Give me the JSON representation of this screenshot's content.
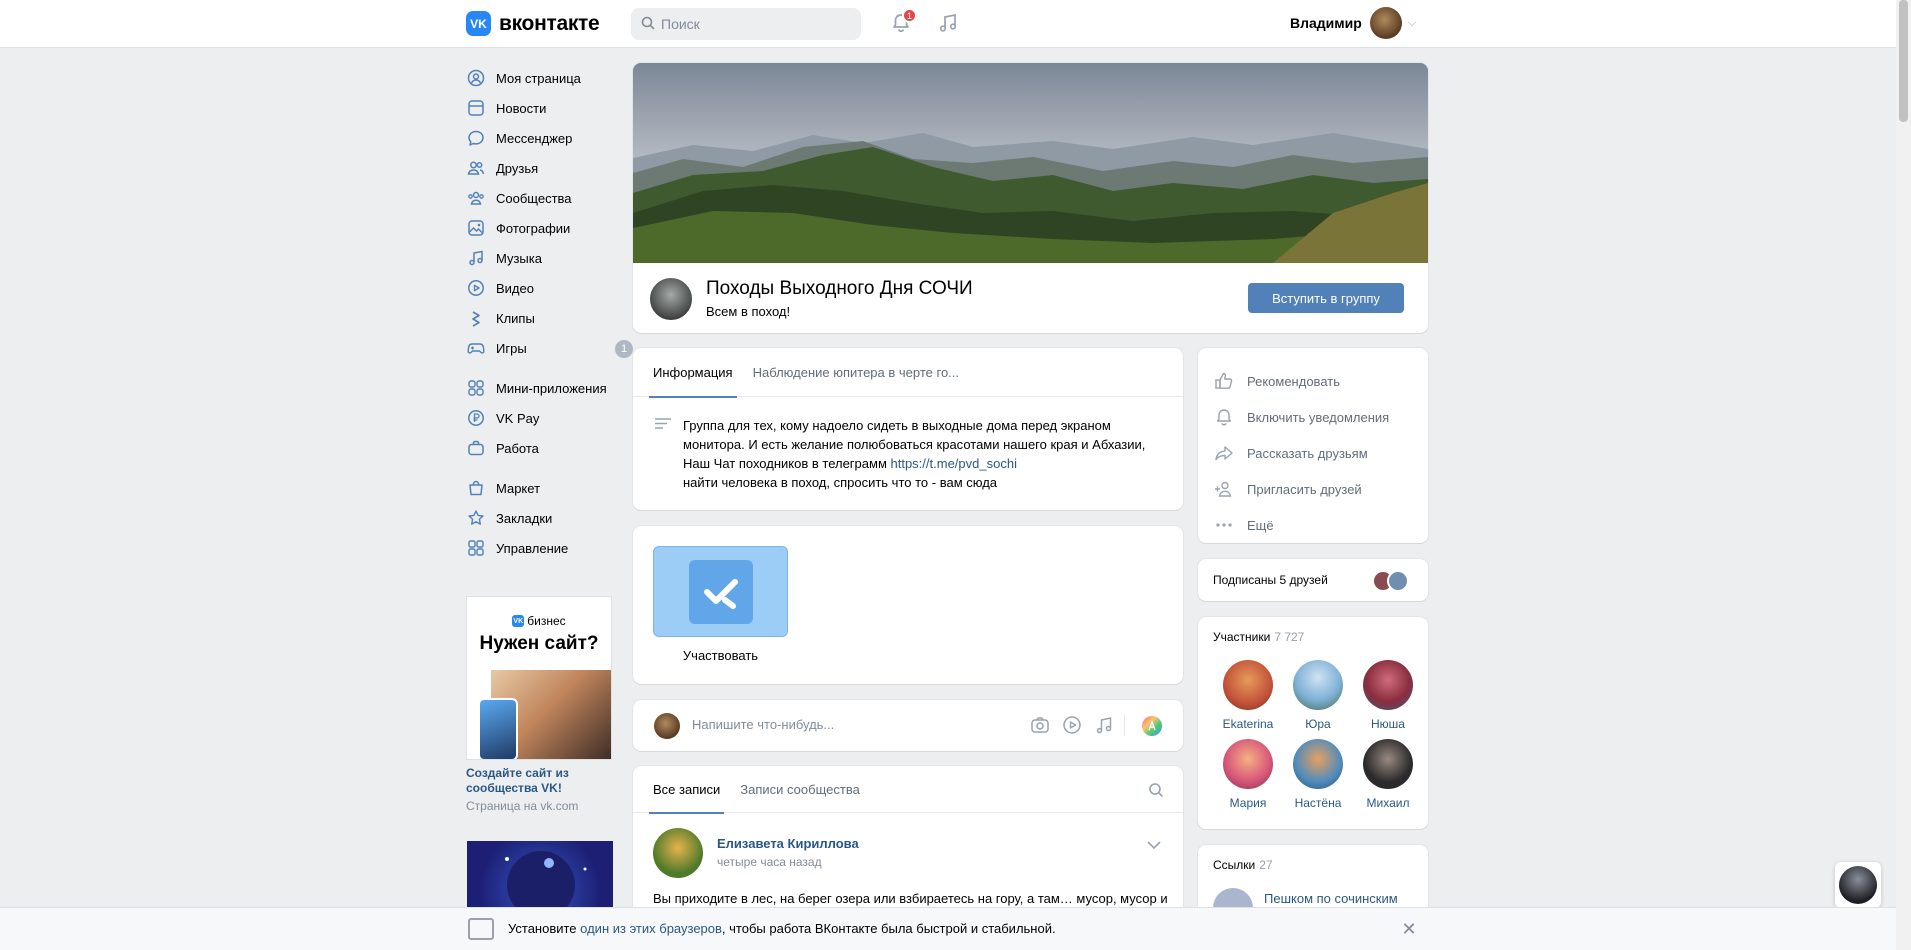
{
  "header": {
    "logo_text": "вконтакте",
    "logo_mark": "VK",
    "search_placeholder": "Поиск",
    "notifications_badge": "1",
    "user_name": "Владимир"
  },
  "sidebar": {
    "items": [
      {
        "label": "Моя страница",
        "icon": "user-circle-icon"
      },
      {
        "label": "Новости",
        "icon": "newspaper-icon"
      },
      {
        "label": "Мессенджер",
        "icon": "chat-bubble-icon"
      },
      {
        "label": "Друзья",
        "icon": "friends-icon"
      },
      {
        "label": "Сообщества",
        "icon": "communities-icon"
      },
      {
        "label": "Фотографии",
        "icon": "photo-icon"
      },
      {
        "label": "Музыка",
        "icon": "music-icon"
      },
      {
        "label": "Видео",
        "icon": "video-icon"
      },
      {
        "label": "Клипы",
        "icon": "clips-icon"
      },
      {
        "label": "Игры",
        "icon": "gamepad-icon",
        "badge": "1"
      },
      {
        "label": "Мини-приложения",
        "icon": "apps-icon"
      },
      {
        "label": "VK Pay",
        "icon": "vkpay-icon"
      },
      {
        "label": "Работа",
        "icon": "briefcase-icon"
      },
      {
        "label": "Маркет",
        "icon": "bag-icon"
      },
      {
        "label": "Закладки",
        "icon": "star-icon"
      },
      {
        "label": "Управление",
        "icon": "grid-icon"
      }
    ],
    "ad": {
      "brand": "бизнес",
      "headline": "Нужен сайт?",
      "caption": "Создайте сайт из сообщества VK!",
      "source": "Страница на vk.com"
    }
  },
  "group": {
    "name": "Походы Выходного Дня СОЧИ",
    "status": "Всем в поход!",
    "join_label": "Вступить в группу"
  },
  "info": {
    "tabs": [
      "Информация",
      "Наблюдение юпитера в черте го..."
    ],
    "text_line1": "Группа для тех, кому надоело сидеть в выходные дома перед экраном",
    "text_line2": "монитора. И есть желание полюбоваться красотами нашего края и Абхазии,",
    "text_line3_prefix": "Наш Чат походников в телеграмм ",
    "text_link": "https://t.me/pvd_sochi",
    "text_line4": "найти человека в поход, спросить что то - вам сюда"
  },
  "app": {
    "label": "Участвовать"
  },
  "compose": {
    "placeholder": "Напишите что-нибудь..."
  },
  "wall": {
    "tabs": [
      "Все записи",
      "Записи сообщества"
    ],
    "post": {
      "author": "Елизавета Кириллова",
      "time": "четыре часа назад",
      "text": "Вы приходите в лес, на берег озера или взбираетесь на гору, а там… мусор, мусор и"
    }
  },
  "actions": [
    {
      "label": "Рекомендовать",
      "icon": "thumbs-up-icon"
    },
    {
      "label": "Включить уведомления",
      "icon": "bell-icon"
    },
    {
      "label": "Рассказать друзьям",
      "icon": "share-icon"
    },
    {
      "label": "Пригласить друзей",
      "icon": "add-user-icon"
    },
    {
      "label": "Ещё",
      "icon": "more-icon"
    }
  ],
  "friends_subscribed": "Подписаны 5 друзей",
  "members": {
    "title": "Участники",
    "count": "7 727",
    "list": [
      {
        "name": "Ekaterina",
        "color": "#c2523a"
      },
      {
        "name": "Юра",
        "color": "#7fb0d6"
      },
      {
        "name": "Нюша",
        "color": "#8a2e3e"
      },
      {
        "name": "Мария",
        "color": "#d95a7a"
      },
      {
        "name": "Настёна",
        "color": "#4d8bbd"
      },
      {
        "name": "Михаил",
        "color": "#2b2a2c"
      }
    ]
  },
  "links": {
    "title": "Ссылки",
    "count": "27",
    "first": "Пешком по сочинским"
  },
  "bottom_bar": {
    "prefix": "Установите ",
    "link": "один из этих браузеров",
    "suffix": ", чтобы работа ВКонтакте была быстрой и стабильной."
  },
  "colors": {
    "accent": "#5181b8",
    "link": "#2a5885",
    "brand": "#2787f5"
  }
}
